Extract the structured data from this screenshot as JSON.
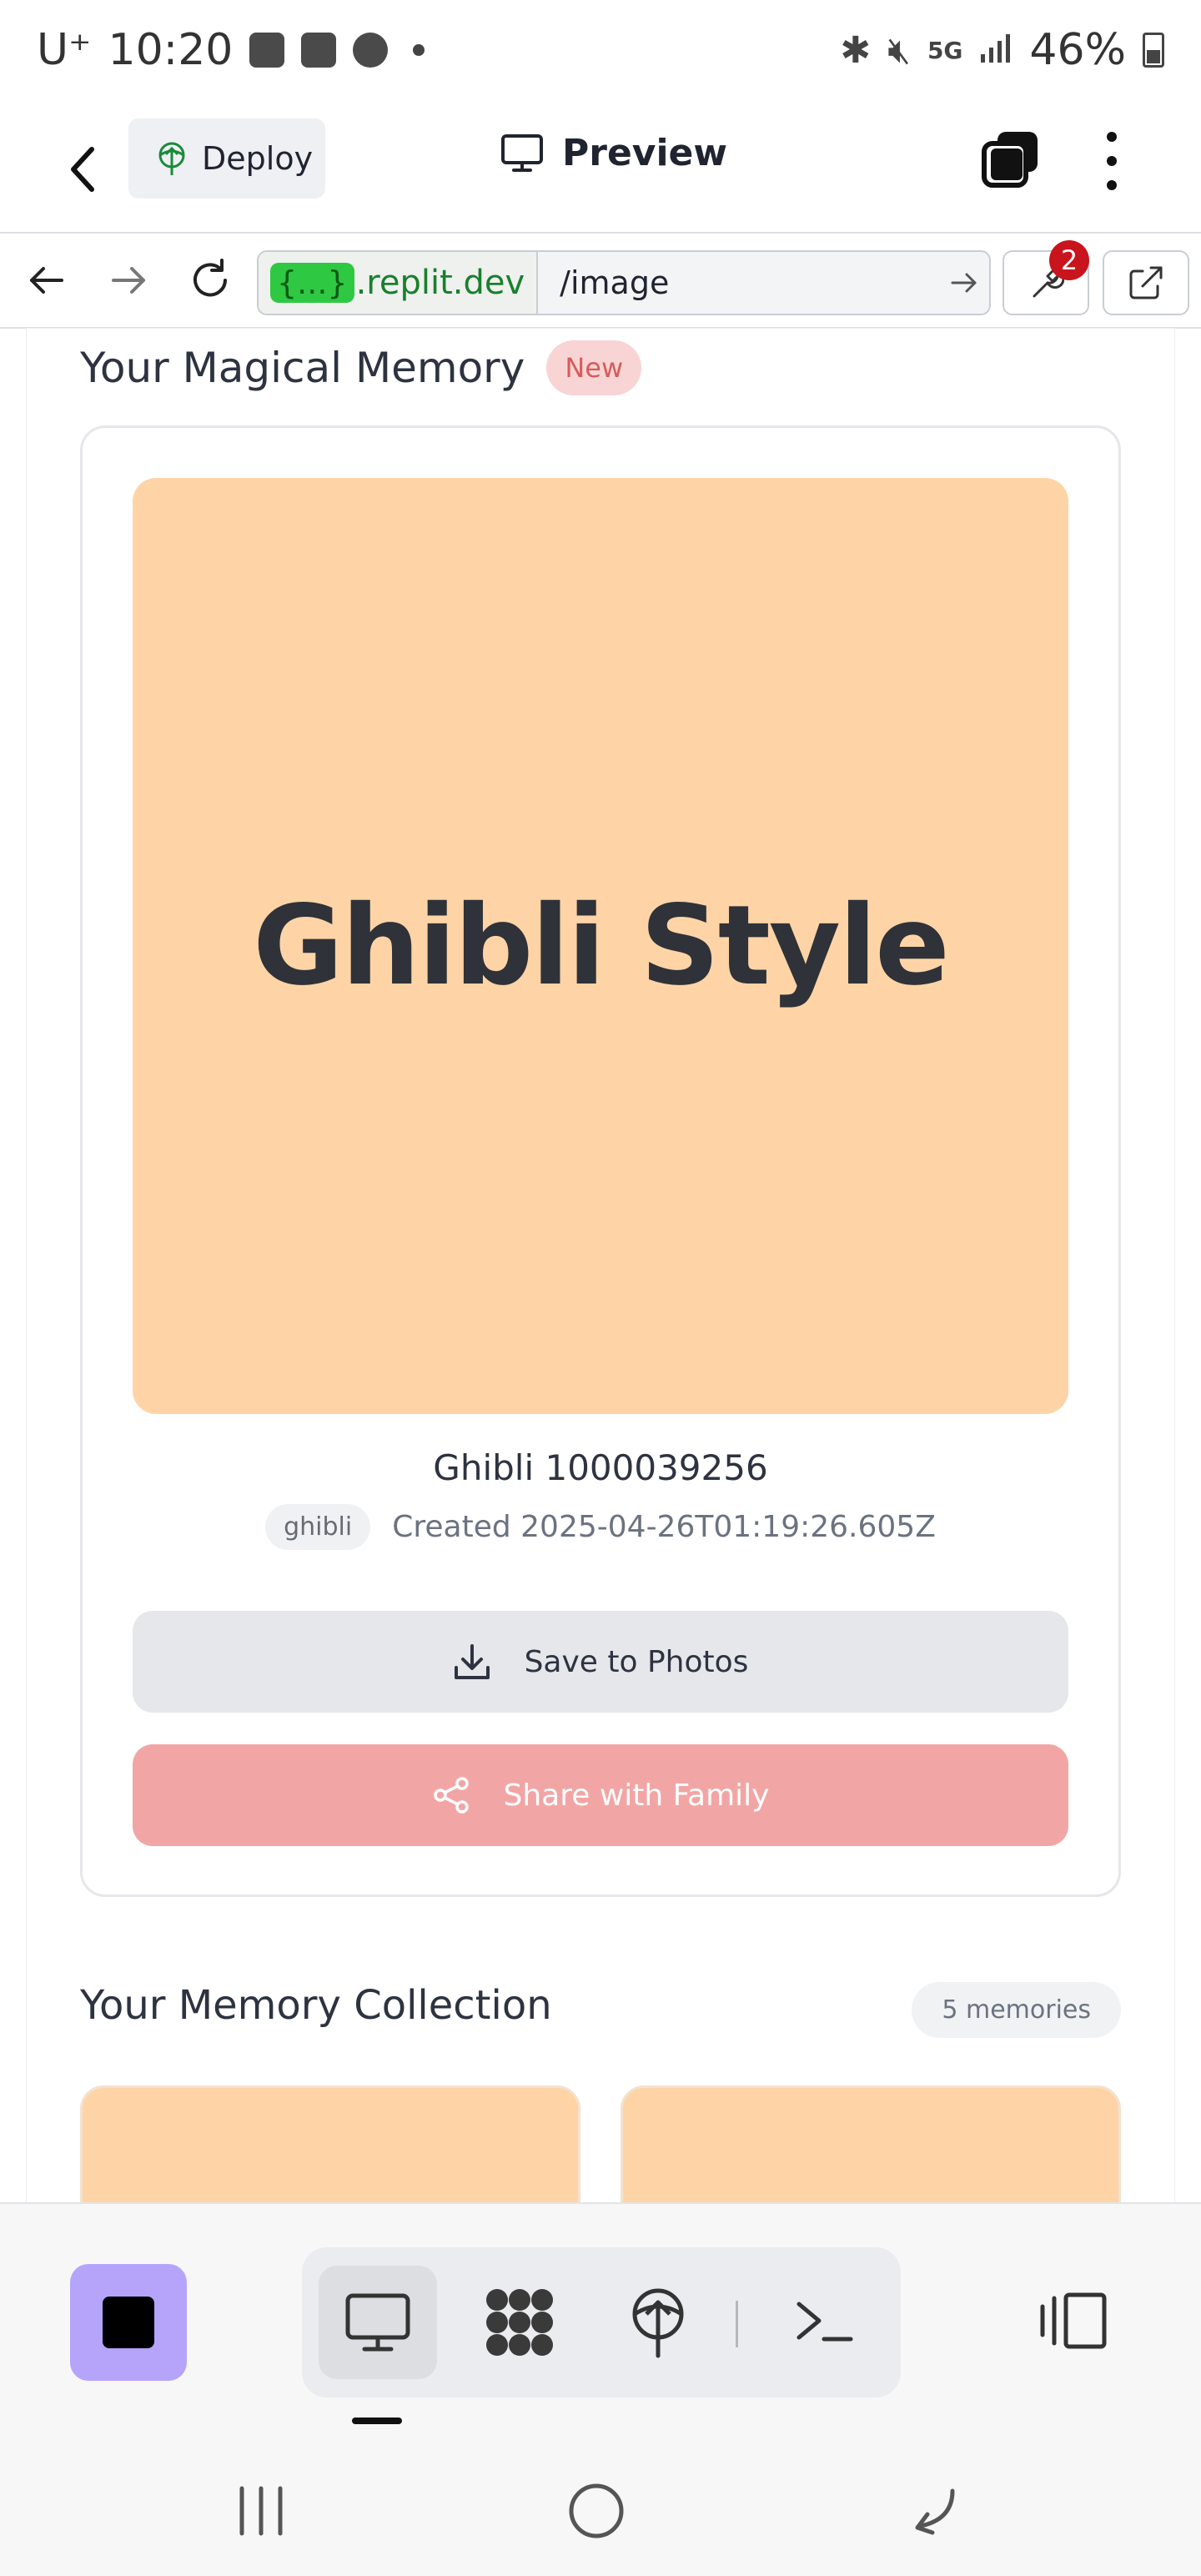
{
  "status_bar": {
    "carrier": "U⁺",
    "time": "10:20",
    "battery": "46%"
  },
  "app_header": {
    "deploy_label": "Deploy",
    "preview_label": "Preview"
  },
  "url_bar": {
    "host_chip": "{...}",
    "host": ".replit.dev",
    "path": "/image",
    "devtools_badge": "2"
  },
  "memory": {
    "section_title": "Your Magical Memory",
    "new_badge": "New",
    "image_text": "Ghibli Style",
    "image_title": "Ghibli 1000039256",
    "tag": "ghibli",
    "created": "Created 2025-04-26T01:19:26.605Z",
    "save_label": "Save to Photos",
    "share_label": "Share with Family"
  },
  "collection": {
    "title": "Your Memory Collection",
    "count": "5 memories"
  },
  "colors": {
    "image_bg": "#fed4a7",
    "share_button": "#f2a5a5",
    "stop_button": "#b6a4fb",
    "url_chip": "#2fc842"
  },
  "bottom_toolbar": {
    "tabs": [
      "desktop-preview-icon",
      "workflow-icon",
      "deploy-icon",
      "shell-icon"
    ]
  }
}
